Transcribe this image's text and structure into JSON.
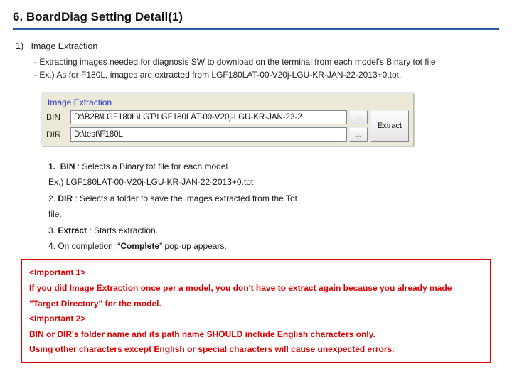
{
  "title": "6.  BoardDiag Setting Detail(1)",
  "section": {
    "num": "1)",
    "heading": "Image Extraction",
    "desc1": "- Extracting images needed for diagnosis SW to download on the terminal from each model's  Binary tot file",
    "desc2": "- Ex.) As for F180L, images are extracted from LGF180LAT-00-V20j-LGU-KR-JAN-22-2013+0.tot."
  },
  "panel": {
    "group_title": "Image Extraction",
    "bin_label": "BIN",
    "bin_value": "D:\\B2B\\LGF180L\\LGT\\LGF180LAT-00-V20j-LGU-KR-JAN-22-2",
    "dir_label": "DIR",
    "dir_value": "D:\\test\\F180L",
    "browse": "...",
    "extract": "Extract"
  },
  "steps": {
    "s1_num": "1.",
    "s1_b": "BIN",
    "s1_rest": " : Selects a Binary tot file for each model",
    "s1_ex": "Ex.) LGF180LAT-00-V20j-LGU-KR-JAN-22-2013+0.tot",
    "s2_pre": "2.  ",
    "s2_b": "DIR",
    "s2_rest": " : Selects a folder to save the images extracted from the Tot",
    "s2_tail": "file.",
    "s3_pre": "3.  ",
    "s3_b": "Extract",
    "s3_rest": " : Starts extraction.",
    "s4_pre": "4.  On completion, “",
    "s4_b": "Complete",
    "s4_post": "” pop-up appears."
  },
  "important": {
    "h1": "<Important 1>",
    "l1": "If you did Image Extraction once per a model, you don't have to extract again because you already made",
    "l2": "\"Target Directory\" for the model.",
    "h2": "<Important 2>",
    "l3": "BIN or DIR's folder name and its path name SHOULD include English characters only.",
    "l4": "Using other characters except  English or special characters will cause unexpected errors."
  }
}
